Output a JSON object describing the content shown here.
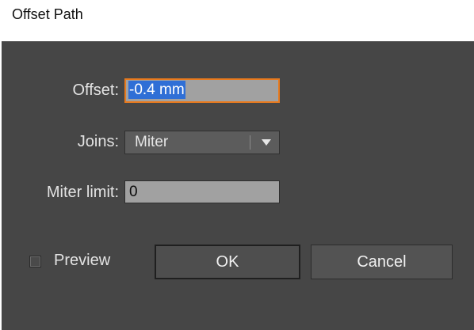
{
  "window": {
    "title": "Offset Path"
  },
  "form": {
    "offset": {
      "label": "Offset:",
      "value": "-0.4 mm"
    },
    "joins": {
      "label": "Joins:",
      "value": "Miter"
    },
    "miter_limit": {
      "label": "Miter limit:",
      "value": "0"
    }
  },
  "preview": {
    "label": "Preview",
    "checked": false
  },
  "buttons": {
    "ok": "OK",
    "cancel": "Cancel"
  },
  "colors": {
    "panel": "#464646",
    "focus_border": "#e87a1e",
    "selection": "#2f6fd6"
  }
}
